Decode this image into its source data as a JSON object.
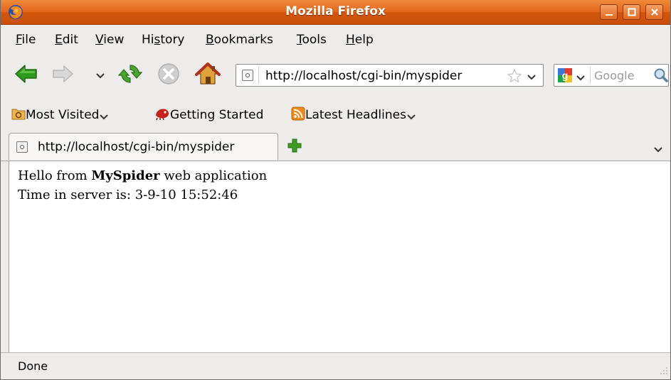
{
  "window": {
    "title": "Mozilla Firefox"
  },
  "menu": {
    "items": [
      {
        "label": "File",
        "key": "F",
        "rest": "ile"
      },
      {
        "label": "Edit",
        "key": "E",
        "rest": "dit"
      },
      {
        "label": "View",
        "key": "V",
        "rest": "iew"
      },
      {
        "label": "History",
        "pre": "Hi",
        "key": "s",
        "rest": "tory"
      },
      {
        "label": "Bookmarks",
        "key": "B",
        "rest": "ookmarks"
      },
      {
        "label": "Tools",
        "key": "T",
        "rest": "ools"
      },
      {
        "label": "Help",
        "key": "H",
        "rest": "elp"
      }
    ]
  },
  "navigation": {
    "url": "http://localhost/cgi-bin/myspider",
    "search_placeholder": "Google"
  },
  "bookmarks": {
    "most_visited": "Most Visited",
    "getting_started": "Getting Started",
    "latest_headlines": "Latest Headlines"
  },
  "tabs": [
    {
      "title": "http://localhost/cgi-bin/myspider"
    }
  ],
  "page": {
    "greeting_before": "Hello from ",
    "greeting_bold": "MySpider",
    "greeting_after": " web application",
    "time_line": "Time in server is: 3-9-10 15:52:46"
  },
  "status": {
    "text": "Done"
  },
  "colors": {
    "titlebar_orange": "#e2661a",
    "back_arrow_green": "#2f9b1c",
    "reload_green": "#4aa52e",
    "new_tab_green": "#3c9d1f"
  }
}
